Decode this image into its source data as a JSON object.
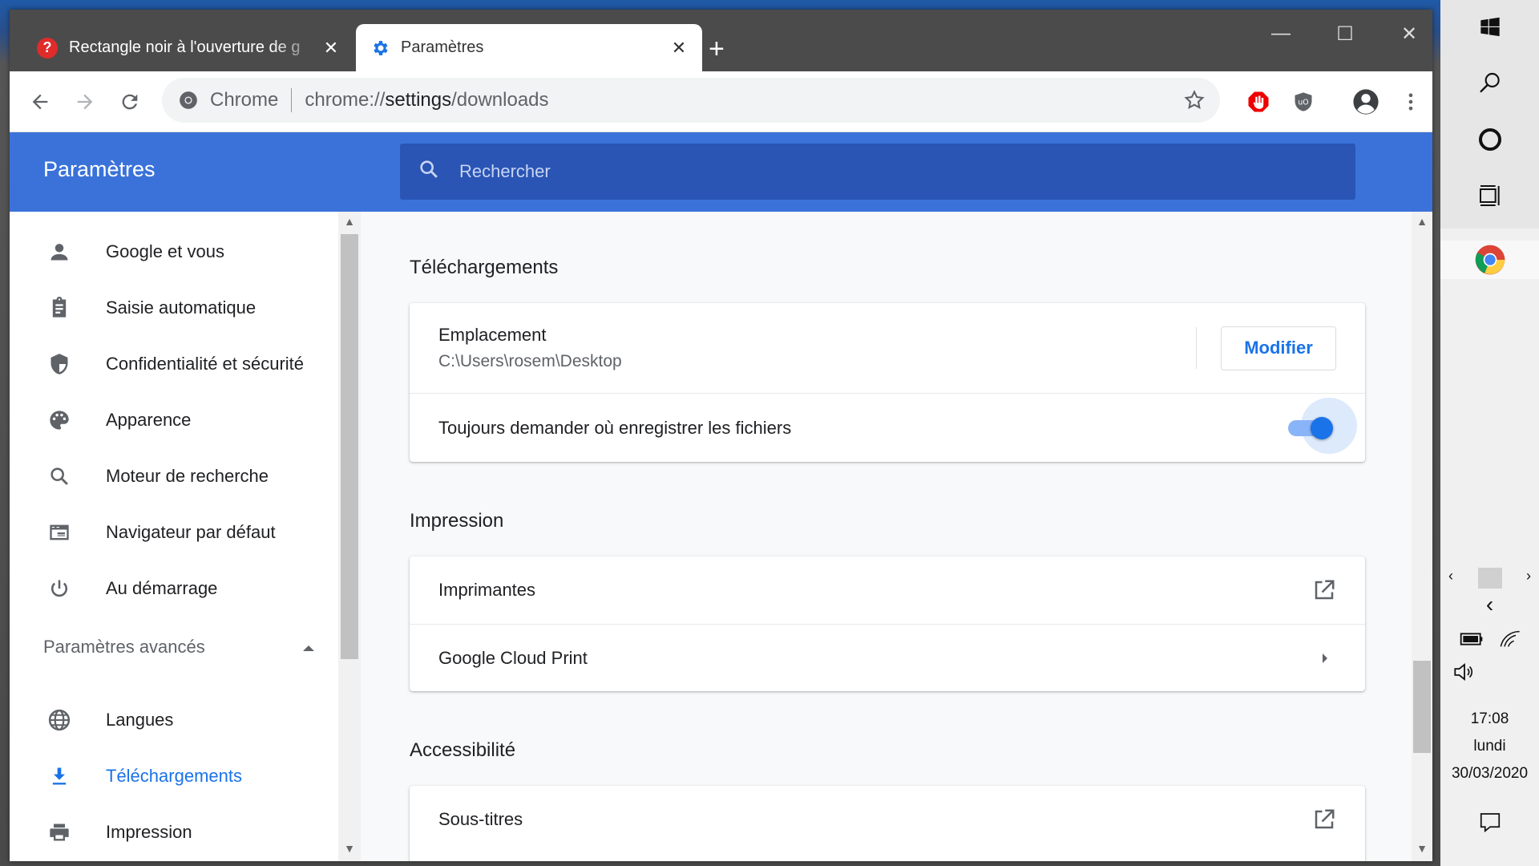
{
  "browser": {
    "tabs": [
      {
        "title": "Rectangle noir à l'ouverture de g",
        "favicon": "help-icon",
        "active": false
      },
      {
        "title": "Paramètres",
        "favicon": "gear-icon",
        "active": true
      }
    ],
    "omnibox": {
      "site_label": "Chrome",
      "url_prefix": "chrome://",
      "url_host": "settings",
      "url_path": "/downloads"
    }
  },
  "settings": {
    "header_title": "Paramètres",
    "search_placeholder": "Rechercher",
    "sidebar": {
      "items": [
        {
          "label": "Google et vous",
          "icon": "person-icon"
        },
        {
          "label": "Saisie automatique",
          "icon": "clipboard-icon"
        },
        {
          "label": "Confidentialité et sécurité",
          "icon": "shield-icon"
        },
        {
          "label": "Apparence",
          "icon": "palette-icon"
        },
        {
          "label": "Moteur de recherche",
          "icon": "search-icon"
        },
        {
          "label": "Navigateur par défaut",
          "icon": "browser-icon"
        },
        {
          "label": "Au démarrage",
          "icon": "power-icon"
        }
      ],
      "advanced_label": "Paramètres avancés",
      "advanced_items": [
        {
          "label": "Langues",
          "icon": "globe-icon"
        },
        {
          "label": "Téléchargements",
          "icon": "download-icon",
          "active": true
        },
        {
          "label": "Impression",
          "icon": "printer-icon"
        }
      ]
    },
    "downloads": {
      "title": "Téléchargements",
      "location_label": "Emplacement",
      "location_path": "C:\\Users\\rosem\\Desktop",
      "modify_button": "Modifier",
      "ask_label": "Toujours demander où enregistrer les fichiers",
      "ask_enabled": true
    },
    "printing": {
      "title": "Impression",
      "printers_label": "Imprimantes",
      "cloud_print_label": "Google Cloud Print"
    },
    "accessibility": {
      "title": "Accessibilité",
      "captions_label": "Sous-titres"
    }
  },
  "taskbar": {
    "time": "17:08",
    "day": "lundi",
    "date": "30/03/2020"
  }
}
